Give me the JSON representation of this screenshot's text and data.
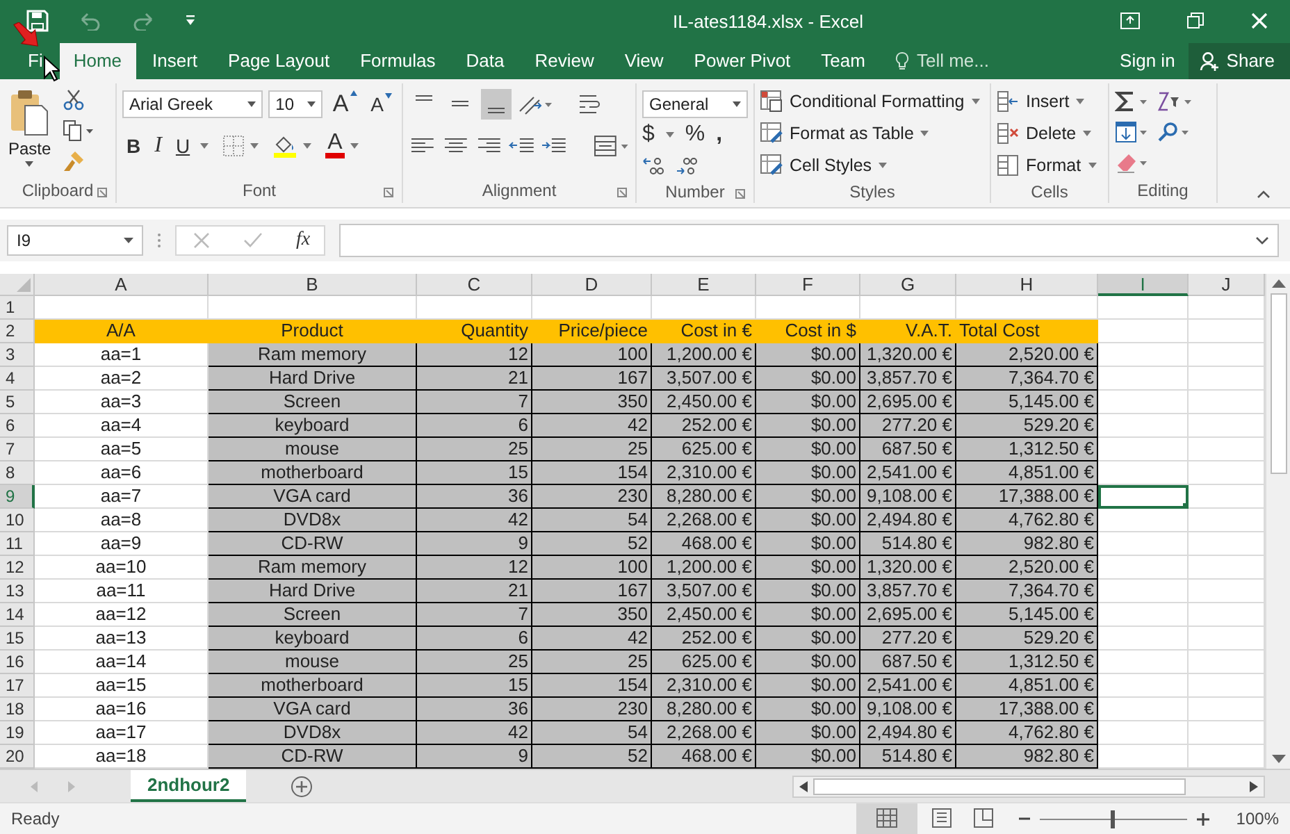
{
  "window": {
    "title": "IL-ates1184.xlsx - Excel",
    "undo_disabled": true,
    "redo_disabled": true
  },
  "tabs": [
    {
      "label": "Fi",
      "selected": false
    },
    {
      "label": "Home",
      "selected": true
    },
    {
      "label": "Insert",
      "selected": false
    },
    {
      "label": "Page Layout",
      "selected": false
    },
    {
      "label": "Formulas",
      "selected": false
    },
    {
      "label": "Data",
      "selected": false
    },
    {
      "label": "Review",
      "selected": false
    },
    {
      "label": "View",
      "selected": false
    },
    {
      "label": "Power Pivot",
      "selected": false
    },
    {
      "label": "Team",
      "selected": false
    }
  ],
  "tell_me": {
    "placeholder": "Tell me..."
  },
  "account": {
    "sign_in": "Sign in",
    "share": "Share"
  },
  "ribbon": {
    "clipboard": {
      "label": "Clipboard",
      "paste": "Paste"
    },
    "font": {
      "label": "Font",
      "family": "Arial Greek",
      "size": "10",
      "grow": "A",
      "shrink": "A",
      "bold": "B",
      "italic": "I",
      "underline": "U",
      "color_letter": "A"
    },
    "alignment": {
      "label": "Alignment",
      "vertical": [
        {
          "selected": false
        },
        {
          "selected": false
        },
        {
          "selected": true
        }
      ]
    },
    "number": {
      "label": "Number",
      "format": "General",
      "currency": "$",
      "percent": "%",
      "comma": ","
    },
    "styles": {
      "label": "Styles",
      "buttons": [
        "Conditional Formatting",
        "Format as Table",
        "Cell Styles"
      ]
    },
    "cells": {
      "label": "Cells",
      "buttons": [
        "Insert",
        "Delete",
        "Format"
      ]
    },
    "editing": {
      "label": "Editing"
    }
  },
  "formula_bar": {
    "name_box": "I9",
    "function_label": "fx"
  },
  "columns": [
    {
      "label": "A",
      "selected": false
    },
    {
      "label": "B",
      "selected": false
    },
    {
      "label": "C",
      "selected": false
    },
    {
      "label": "D",
      "selected": false
    },
    {
      "label": "E",
      "selected": false
    },
    {
      "label": "F",
      "selected": false
    },
    {
      "label": "G",
      "selected": false
    },
    {
      "label": "H",
      "selected": false
    },
    {
      "label": "I",
      "selected": true
    },
    {
      "label": "J",
      "selected": false
    }
  ],
  "rows": [
    {
      "number": "1",
      "kind": "empty",
      "selected": false
    },
    {
      "number": "2",
      "kind": "header",
      "selected": false,
      "cells": [
        "A/A",
        "Product",
        "Quantity",
        "Price/piece",
        "Cost in €",
        "Cost in $",
        "V.A.T.",
        "Total Cost"
      ]
    },
    {
      "number": "3",
      "kind": "data",
      "selected": false,
      "cells": [
        "aa=1",
        "Ram memory",
        "12",
        "100",
        "1,200.00 €",
        "$0.00",
        "1,320.00 €",
        "2,520.00 €"
      ]
    },
    {
      "number": "4",
      "kind": "data",
      "selected": false,
      "cells": [
        "aa=2",
        "Hard Drive",
        "21",
        "167",
        "3,507.00 €",
        "$0.00",
        "3,857.70 €",
        "7,364.70 €"
      ]
    },
    {
      "number": "5",
      "kind": "data",
      "selected": false,
      "cells": [
        "aa=3",
        "Screen",
        "7",
        "350",
        "2,450.00 €",
        "$0.00",
        "2,695.00 €",
        "5,145.00 €"
      ]
    },
    {
      "number": "6",
      "kind": "data",
      "selected": false,
      "cells": [
        "aa=4",
        "keyboard",
        "6",
        "42",
        "252.00 €",
        "$0.00",
        "277.20 €",
        "529.20 €"
      ]
    },
    {
      "number": "7",
      "kind": "data",
      "selected": false,
      "cells": [
        "aa=5",
        "mouse",
        "25",
        "25",
        "625.00 €",
        "$0.00",
        "687.50 €",
        "1,312.50 €"
      ]
    },
    {
      "number": "8",
      "kind": "data",
      "selected": false,
      "cells": [
        "aa=6",
        "motherboard",
        "15",
        "154",
        "2,310.00 €",
        "$0.00",
        "2,541.00 €",
        "4,851.00 €"
      ]
    },
    {
      "number": "9",
      "kind": "data",
      "selected": true,
      "cells": [
        "aa=7",
        "VGA card",
        "36",
        "230",
        "8,280.00 €",
        "$0.00",
        "9,108.00 €",
        "17,388.00 €"
      ]
    },
    {
      "number": "10",
      "kind": "data",
      "selected": false,
      "cells": [
        "aa=8",
        "DVD8x",
        "42",
        "54",
        "2,268.00 €",
        "$0.00",
        "2,494.80 €",
        "4,762.80 €"
      ]
    },
    {
      "number": "11",
      "kind": "data",
      "selected": false,
      "cells": [
        "aa=9",
        "CD-RW",
        "9",
        "52",
        "468.00 €",
        "$0.00",
        "514.80 €",
        "982.80 €"
      ]
    },
    {
      "number": "12",
      "kind": "data",
      "selected": false,
      "cells": [
        "aa=10",
        "Ram memory",
        "12",
        "100",
        "1,200.00 €",
        "$0.00",
        "1,320.00 €",
        "2,520.00 €"
      ]
    },
    {
      "number": "13",
      "kind": "data",
      "selected": false,
      "cells": [
        "aa=11",
        "Hard Drive",
        "21",
        "167",
        "3,507.00 €",
        "$0.00",
        "3,857.70 €",
        "7,364.70 €"
      ]
    },
    {
      "number": "14",
      "kind": "data",
      "selected": false,
      "cells": [
        "aa=12",
        "Screen",
        "7",
        "350",
        "2,450.00 €",
        "$0.00",
        "2,695.00 €",
        "5,145.00 €"
      ]
    },
    {
      "number": "15",
      "kind": "data",
      "selected": false,
      "cells": [
        "aa=13",
        "keyboard",
        "6",
        "42",
        "252.00 €",
        "$0.00",
        "277.20 €",
        "529.20 €"
      ]
    },
    {
      "number": "16",
      "kind": "data",
      "selected": false,
      "cells": [
        "aa=14",
        "mouse",
        "25",
        "25",
        "625.00 €",
        "$0.00",
        "687.50 €",
        "1,312.50 €"
      ]
    },
    {
      "number": "17",
      "kind": "data",
      "selected": false,
      "cells": [
        "aa=15",
        "motherboard",
        "15",
        "154",
        "2,310.00 €",
        "$0.00",
        "2,541.00 €",
        "4,851.00 €"
      ]
    },
    {
      "number": "18",
      "kind": "data",
      "selected": false,
      "cells": [
        "aa=16",
        "VGA card",
        "36",
        "230",
        "8,280.00 €",
        "$0.00",
        "9,108.00 €",
        "17,388.00 €"
      ]
    },
    {
      "number": "19",
      "kind": "data",
      "selected": false,
      "cells": [
        "aa=17",
        "DVD8x",
        "42",
        "54",
        "2,268.00 €",
        "$0.00",
        "2,494.80 €",
        "4,762.80 €"
      ]
    },
    {
      "number": "20",
      "kind": "data",
      "selected": false,
      "cells": [
        "aa=18",
        "CD-RW",
        "9",
        "52",
        "468.00 €",
        "$0.00",
        "514.80 €",
        "982.80 €"
      ]
    }
  ],
  "sheet_tabs": [
    {
      "label": "2ndhour2",
      "selected": true
    }
  ],
  "status_bar": {
    "text": "Ready",
    "zoom": {
      "level": 0.5,
      "label": "100%"
    }
  }
}
